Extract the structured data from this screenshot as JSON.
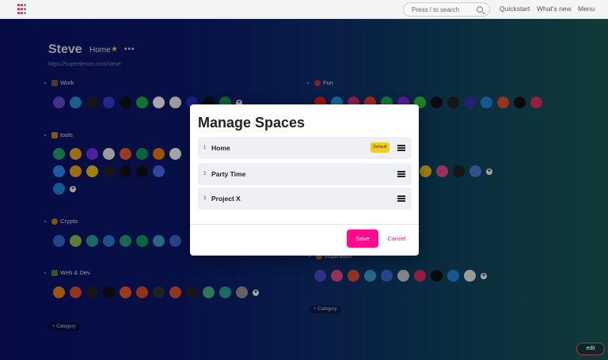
{
  "topbar": {
    "search_placeholder": "Press / to search",
    "links": [
      "Quickstart",
      "What's new",
      "Menu"
    ]
  },
  "page": {
    "title": "Steve",
    "space": "Home",
    "more": "•••",
    "url": "https://superdenoo.com/steve"
  },
  "sections": {
    "work": "Work",
    "fun": "Fun",
    "tools": "tools",
    "crypto": "Crypto",
    "webdev": "Web & Dev",
    "inspiration": "Inspiration"
  },
  "category_buttons": [
    "+ Category",
    "+ Category"
  ],
  "modal": {
    "title": "Manage Spaces",
    "rows": [
      {
        "num": "1",
        "name": "Home",
        "badge": "Default"
      },
      {
        "num": "2",
        "name": "Party Time"
      },
      {
        "num": "3",
        "name": "Project X"
      }
    ],
    "save_label": "Save",
    "cancel_label": "Cancel"
  },
  "edit_label": "edit",
  "icon_colors": {
    "work": [
      "#6a4bd6",
      "#2d8fd6",
      "#222",
      "#3a3ad6",
      "#111",
      "#16b24a",
      "#fff",
      "#eee",
      "#2c2cc0",
      "#111",
      "#1a9a4a"
    ],
    "fun": [
      "#e02020",
      "#1da1f2",
      "#d8316f",
      "#ff3b30",
      "#1db954",
      "#8a2be2",
      "#2ecc40",
      "#111",
      "#222",
      "#3a2fb0",
      "#1e88e5",
      "#e05030",
      "#111",
      "#e03060"
    ],
    "tools1": [
      "#1ea672",
      "#f5a623",
      "#7a2ef5",
      "#eee",
      "#f05a28",
      "#0f9d58",
      "#f57c00",
      "#fff"
    ],
    "tools2": [
      "#2d8cff",
      "#f5a623",
      "#f5c518",
      "#222",
      "#111",
      "#111",
      "#4a6cf7"
    ],
    "tools3": [
      "#1e88e5"
    ],
    "crypto": [
      "#3a6bd6",
      "#8bc34a",
      "#26a69a",
      "#2e7bd6",
      "#27a17c",
      "#0ba360",
      "#3aa0c8",
      "#3a68d6"
    ],
    "webdev": [
      "#f48120",
      "#e05030",
      "#222",
      "#111",
      "#f05a28",
      "#e44d26",
      "#333",
      "#e05030",
      "#222",
      "#41b883",
      "#26a69a",
      "#999"
    ],
    "mid_fun": [
      "#f5c518",
      "#ea4c89",
      "#222",
      "#4a7bd6"
    ],
    "inspiration": [
      "#4a4ad6",
      "#ea4c89",
      "#e05030",
      "#3aa0c8",
      "#3a6bd6",
      "#ccc",
      "#e03060",
      "#111",
      "#1e88e5",
      "#eee"
    ]
  }
}
